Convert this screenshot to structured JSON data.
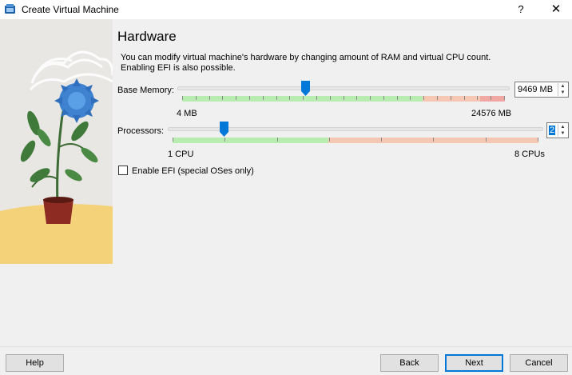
{
  "window": {
    "title": "Create Virtual Machine",
    "help_glyph": "?",
    "close_glyph": "✕"
  },
  "page": {
    "heading": "Hardware",
    "description_line1": "You can modify virtual machine's hardware by changing amount of RAM and virtual CPU count.",
    "description_line2": "Enabling EFI is also possible."
  },
  "memory": {
    "label": "Base Memory:",
    "value": 9469,
    "value_text": "9469 MB",
    "min_label": "4 MB",
    "max_label": "24576 MB",
    "min": 4,
    "max": 24576
  },
  "processors": {
    "label": "Processors:",
    "value": 2,
    "value_text": "2",
    "min_label": "1 CPU",
    "max_label": "8 CPUs",
    "min": 1,
    "max": 8
  },
  "efi": {
    "label": "Enable EFI (special OSes only)",
    "checked": false
  },
  "buttons": {
    "help": "Help",
    "back": "Back",
    "next": "Next",
    "cancel": "Cancel"
  },
  "colors": {
    "accent": "#0078d7",
    "scale_ok": "#b8ecb0",
    "scale_warn": "#f6c8b4",
    "scale_bad": "#f1a8a4"
  },
  "icons": {
    "app": "virtualbox-icon",
    "memory_thumb": "slider-thumb-icon",
    "processor_thumb": "slider-thumb-icon"
  }
}
